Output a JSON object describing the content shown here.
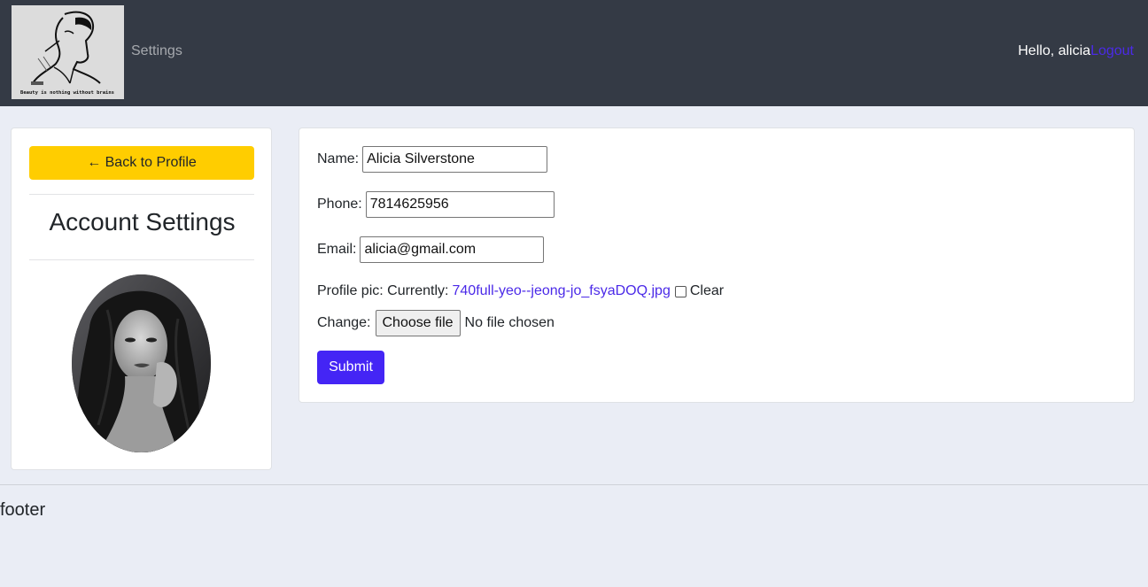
{
  "navbar": {
    "logo_caption": "Beauty is nothing without brains",
    "settings_link": "Settings",
    "greeting": "Hello, alicia",
    "logout_link": "Logout"
  },
  "sidebar": {
    "back_button": "← Back to Profile",
    "title": "Account Settings"
  },
  "form": {
    "name_label": "Name:",
    "name_value": "Alicia Silverstone",
    "phone_label": "Phone:",
    "phone_value": "7814625956",
    "email_label": "Email:",
    "email_value": "alicia@gmail.com",
    "pic_label": "Profile pic: Currently:",
    "pic_filename": "740full-yeo--jeong-jo_fsyaDOQ.jpg",
    "clear_label": "Clear",
    "change_label": "Change:",
    "choose_file": "Choose file",
    "file_status": "No file chosen",
    "submit": "Submit"
  },
  "footer": {
    "text": "footer"
  },
  "colors": {
    "navbar_bg": "#343a45",
    "page_bg": "#eaedf5",
    "back_button_bg": "#ffcd00",
    "submit_bg": "#4425f5",
    "link": "#4b2ae8"
  }
}
